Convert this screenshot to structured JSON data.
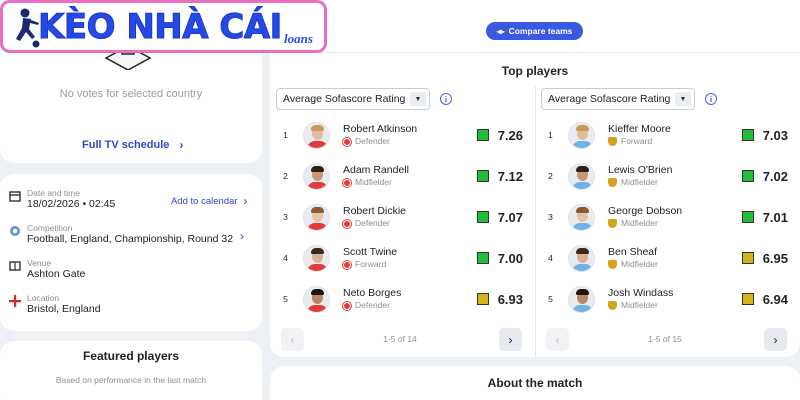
{
  "brand": {
    "logo_text": "KÈO NHÀ CÁI",
    "logo_suffix": "loans"
  },
  "votes": {
    "empty_text": "No votes for selected country",
    "tv_link": "Full TV schedule"
  },
  "event_info": {
    "date_label": "Date and time",
    "date_value": "18/02/2026 • 02:45",
    "add_calendar": "Add to calendar",
    "competition_label": "Competition",
    "competition_value": "Football, England, Championship, Round 32",
    "venue_label": "Venue",
    "venue_value": "Ashton Gate",
    "location_label": "Location",
    "location_value": "Bristol, England"
  },
  "featured": {
    "title": "Featured players",
    "subtitle": "Based on performance in the last match"
  },
  "compare_button": "Compare teams",
  "top_players": {
    "title": "Top players",
    "left": {
      "select_value": "Average Sofascore Rating",
      "pager_text": "1-5 of 14",
      "players": [
        {
          "rank": "1",
          "name": "Robert Atkinson",
          "position": "Defender",
          "rating": "7.26",
          "color": "#1fbf3a"
        },
        {
          "rank": "2",
          "name": "Adam Randell",
          "position": "Midfielder",
          "rating": "7.12",
          "color": "#1fbf3a"
        },
        {
          "rank": "3",
          "name": "Robert Dickie",
          "position": "Defender",
          "rating": "7.07",
          "color": "#1fbf3a"
        },
        {
          "rank": "4",
          "name": "Scott Twine",
          "position": "Forward",
          "rating": "7.00",
          "color": "#1fbf3a"
        },
        {
          "rank": "5",
          "name": "Neto Borges",
          "position": "Defender",
          "rating": "6.93",
          "color": "#d4b21a"
        }
      ]
    },
    "right": {
      "select_value": "Average Sofascore Rating",
      "pager_text": "1-5 of 15",
      "players": [
        {
          "rank": "1",
          "name": "Kieffer Moore",
          "position": "Forward",
          "rating": "7.03",
          "color": "#1fbf3a"
        },
        {
          "rank": "2",
          "name": "Lewis O'Brien",
          "position": "Midfielder",
          "rating": "7.02",
          "color": "#1fbf3a"
        },
        {
          "rank": "3",
          "name": "George Dobson",
          "position": "Midfielder",
          "rating": "7.01",
          "color": "#1fbf3a"
        },
        {
          "rank": "4",
          "name": "Ben Sheaf",
          "position": "Midfielder",
          "rating": "6.95",
          "color": "#d4b21a"
        },
        {
          "rank": "5",
          "name": "Josh Windass",
          "position": "Midfielder",
          "rating": "6.94",
          "color": "#d4b21a"
        }
      ]
    }
  },
  "about": {
    "title": "About the match"
  },
  "colors": {
    "accent": "#2d49c9",
    "rating_high": "#1fbf3a",
    "rating_mid": "#d4b21a",
    "home_team": "#e33b3b",
    "away_team": "#d9a21e"
  }
}
